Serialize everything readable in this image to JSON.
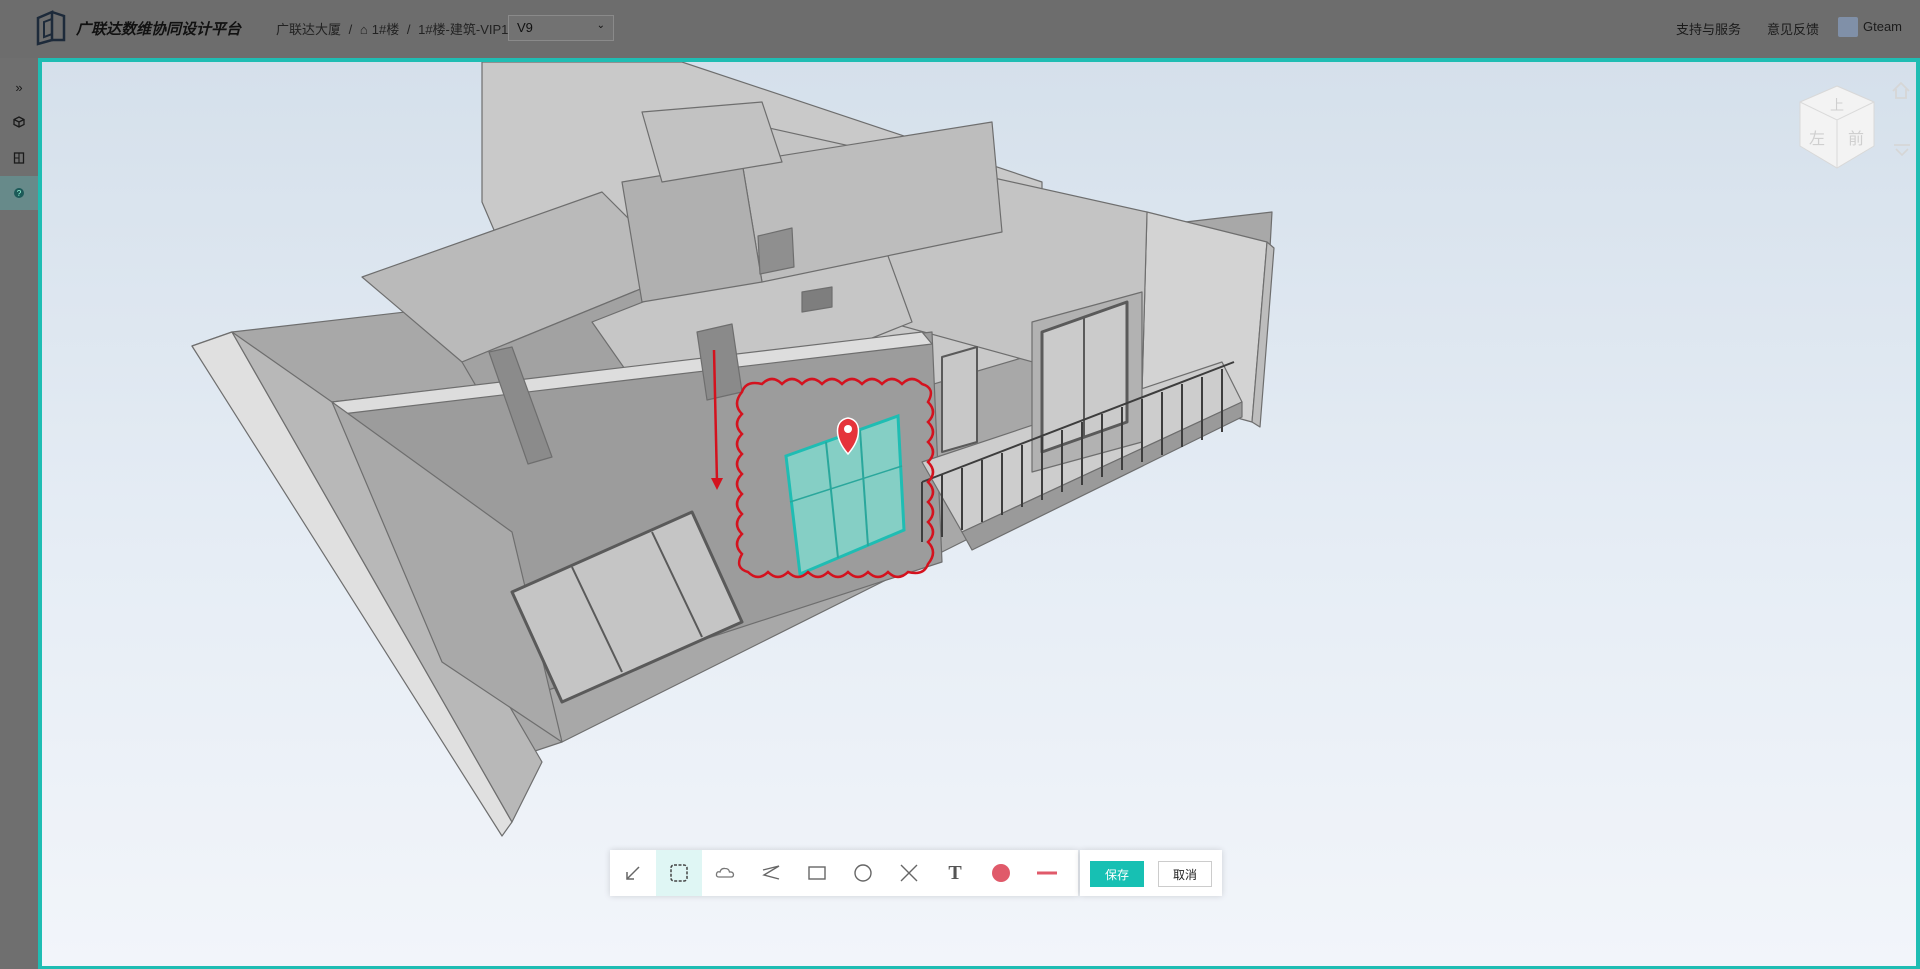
{
  "header": {
    "app_title": "广联达数维协同设计平台",
    "breadcrumb": {
      "project": "广联达大厦",
      "sep": "/",
      "building": "1#楼",
      "model": "1#楼-建筑-VIP1"
    },
    "version": {
      "selected": "V9"
    },
    "links": {
      "support": "支持与服务",
      "feedback": "意见反馈"
    },
    "user": {
      "name": "Gteam"
    }
  },
  "sidebar": {
    "items": [
      {
        "icon": "expand-icon"
      },
      {
        "icon": "model-cube-icon"
      },
      {
        "icon": "drawing-icon"
      },
      {
        "icon": "help-icon",
        "active": true
      }
    ]
  },
  "viewport": {
    "nav_cube": {
      "top_face": "上",
      "left_face": "左",
      "front_face": "前"
    }
  },
  "markup_toolbar": {
    "tools": [
      "arrow-icon",
      "region-select-icon",
      "cloud-icon",
      "polyline-icon",
      "rectangle-icon",
      "circle-icon",
      "cross-icon",
      "text-icon",
      "color-icon",
      "line-width-icon"
    ],
    "active_tool": "region-select-icon",
    "text_tool_glyph": "T",
    "markup_color": "#e05a6a",
    "save_label": "保存",
    "cancel_label": "取消"
  },
  "colors": {
    "accent": "#1fbdb3",
    "markup_red": "#d4121e",
    "selection_teal": "#7fdcd0"
  }
}
